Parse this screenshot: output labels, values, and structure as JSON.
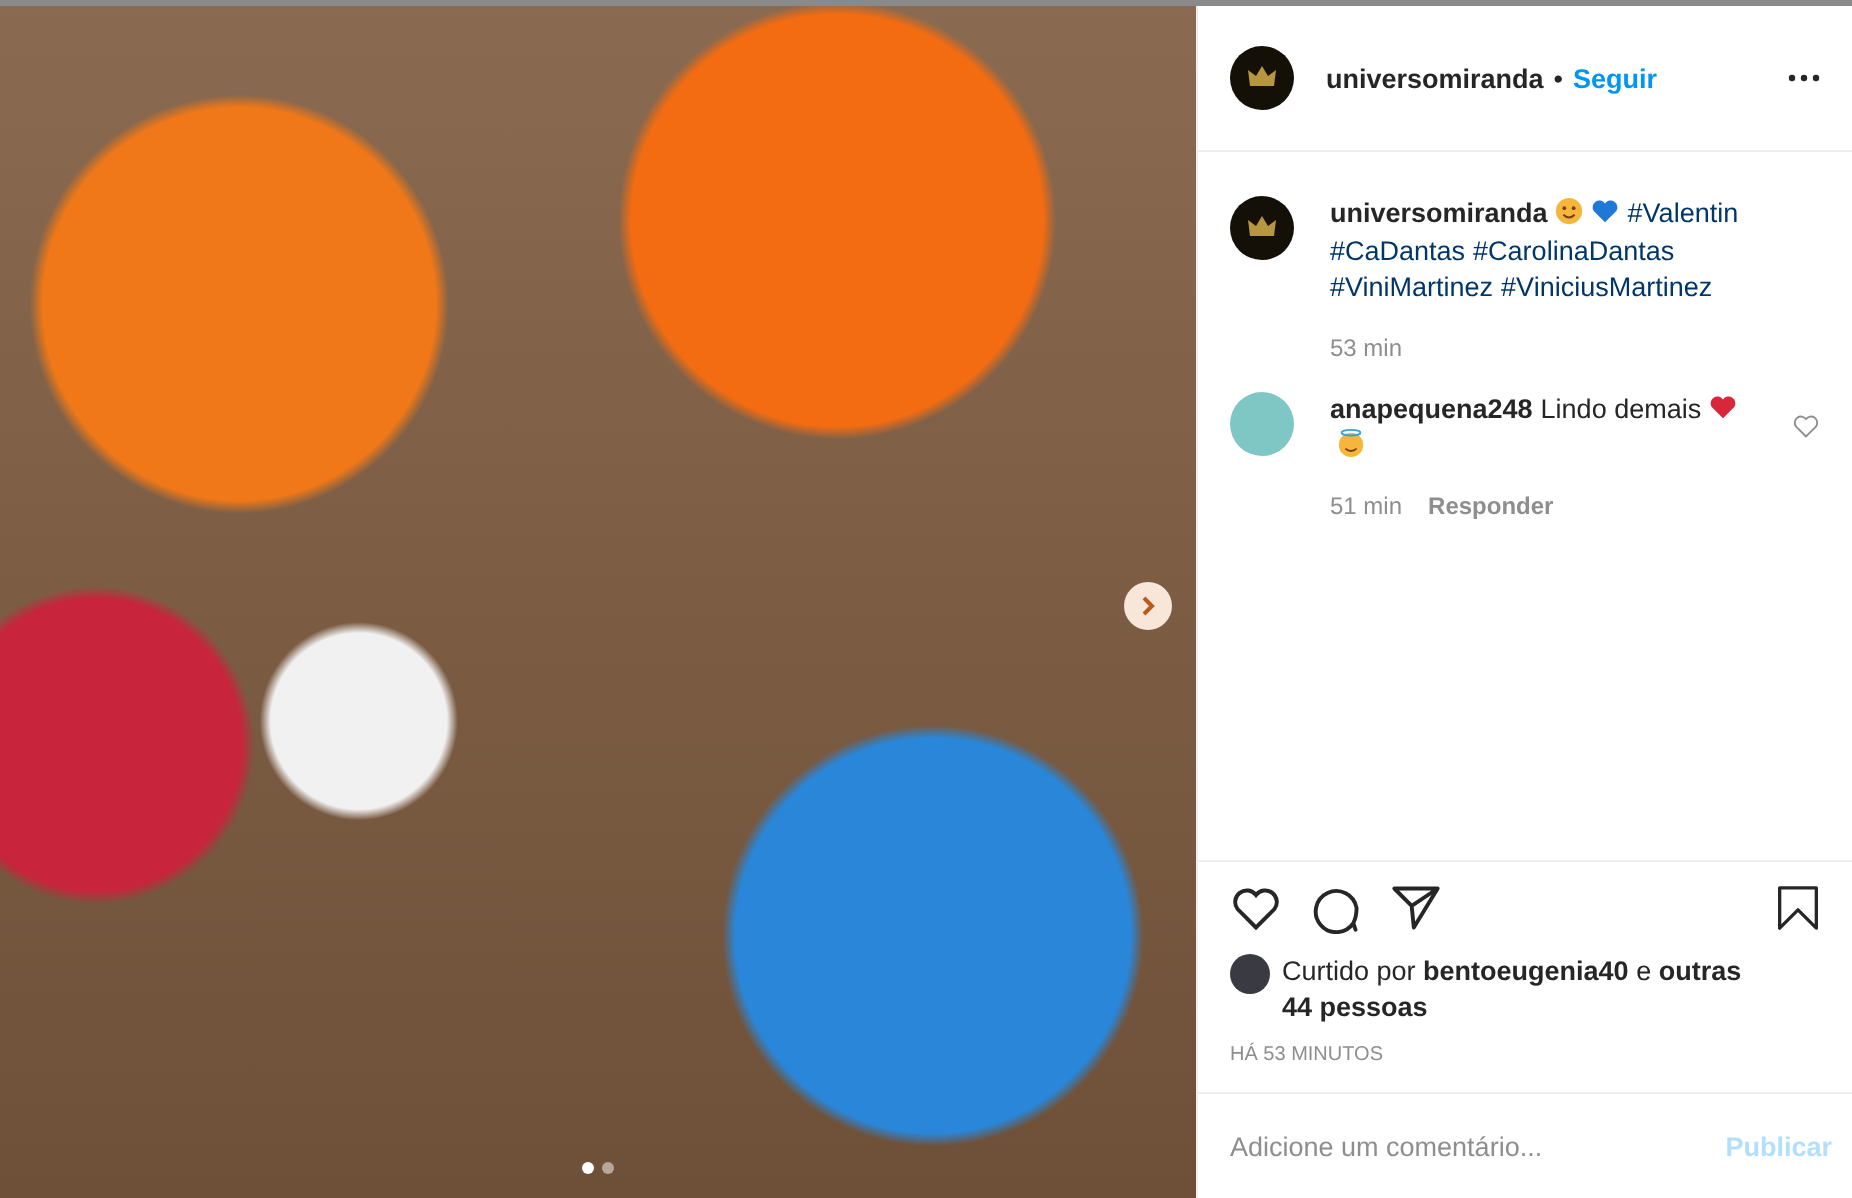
{
  "post": {
    "carousel_dots": [
      {
        "selected": true
      },
      {
        "selected": false
      }
    ]
  },
  "header": {
    "username": "universomiranda",
    "separator": "•",
    "follow": "Seguir"
  },
  "caption": {
    "username": "universomiranda",
    "hashtags": [
      "#Valentin",
      "#CaDantas",
      "#CarolinaDantas",
      "#ViniMartinez",
      "#ViniciusMartinez"
    ],
    "time": "53 min"
  },
  "comments": [
    {
      "username": "anapequena248",
      "text": "Lindo demais",
      "time": "51 min",
      "reply": "Responder",
      "liked": false
    }
  ],
  "likes": {
    "text": "Curtido por **bentoeugenia40** e **outras 44 pessoas**"
  },
  "timestamp": "HÁ 53 MINUTOS",
  "comment_box": {
    "placeholder": "Adicione um comentário...",
    "submit": "Publicar"
  }
}
